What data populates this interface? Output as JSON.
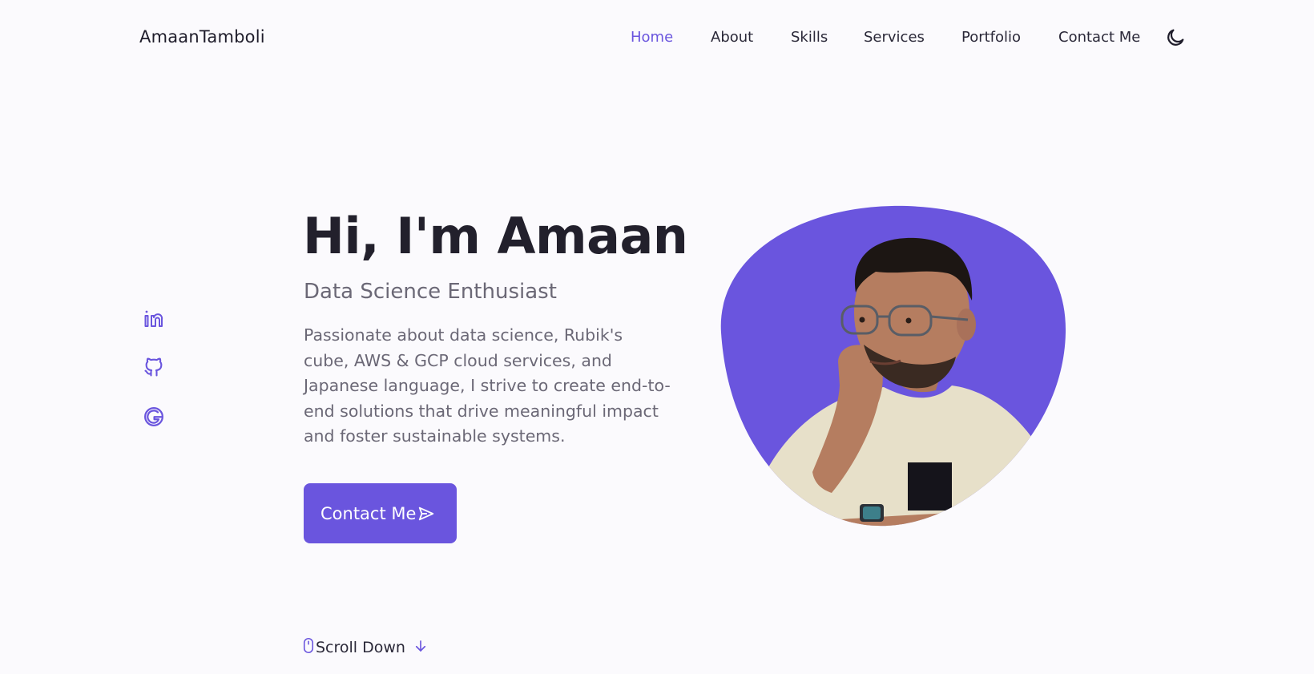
{
  "header": {
    "logo": "AmaanTamboli",
    "nav": [
      "Home",
      "About",
      "Skills",
      "Services",
      "Portfolio",
      "Contact Me"
    ],
    "active_nav": "Home",
    "theme_toggle_icon": "moon-icon"
  },
  "socials": [
    {
      "icon": "linkedin-icon"
    },
    {
      "icon": "github-icon"
    },
    {
      "icon": "google-icon"
    }
  ],
  "hero": {
    "title": "Hi, I'm Amaan",
    "subtitle": "Data Science Enthusiast",
    "description": "Passionate about data science, Rubik's cube, AWS & GCP cloud services, and Japanese language, I strive to create end-to-end solutions that drive meaningful impact and foster sustainable systems.",
    "cta_label": "Contact Me",
    "cta_icon": "send-icon"
  },
  "scroll": {
    "label": "Scroll Down",
    "icon_left": "mouse-icon",
    "icon_right": "arrow-down-icon"
  },
  "colors": {
    "accent": "#6a55de",
    "background": "#fbfafd",
    "text": "#22202c",
    "muted": "#6b6876"
  }
}
